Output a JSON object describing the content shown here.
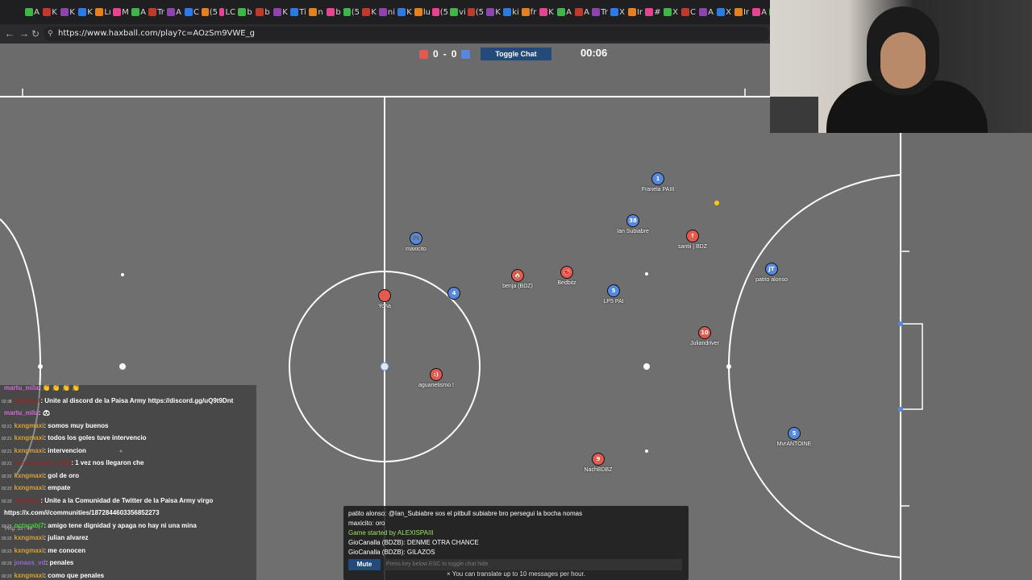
{
  "browser": {
    "url": "https://www.haxball.com/play?c=AOzSm9VWE_g",
    "tabs": [
      "A",
      "K",
      "K",
      "K",
      "Lı",
      "M",
      "A",
      "Tr",
      "A",
      "C",
      "(5",
      "LC",
      "b",
      "b",
      "K",
      "Ti",
      "n",
      "b",
      "(5",
      "K",
      "ni",
      "K",
      "lu",
      "(5",
      "vi",
      "(5",
      "K",
      "ki",
      "fr",
      "K",
      "A",
      "A",
      "Tr",
      "X",
      "Ir",
      "#",
      "X",
      "C",
      "A",
      "X",
      "Ir",
      "A",
      "Si"
    ]
  },
  "game": {
    "score_red": "0",
    "score_separator": "-",
    "score_blue": "0",
    "toggle_chat": "Toggle Chat",
    "clock": "00:06",
    "colors": {
      "red": "#e35a4e",
      "blue": "#5788e0",
      "pitch": "#6b6b6b",
      "lines": "#ffffff",
      "ball": "#ffcc00"
    },
    "players": [
      {
        "team": "blue",
        "number": "1",
        "name": "Franela PAIII"
      },
      {
        "team": "blue",
        "number": "38",
        "name": "Ian Subiabre"
      },
      {
        "team": "red",
        "number": "↑",
        "name": "santii | BDZ"
      },
      {
        "team": "blue",
        "number": "🎮",
        "name": "maxicito"
      },
      {
        "team": "red",
        "number": "🏠",
        "name": "benja (BDZ)"
      },
      {
        "team": "red",
        "number": "🥩",
        "name": "Bedbitz"
      },
      {
        "team": "blue",
        "number": "5",
        "name": "LP5 PAI"
      },
      {
        "team": "blue",
        "number": "JT",
        "name": "patito alonso"
      },
      {
        "team": "red",
        "number": "",
        "name": "Yoha"
      },
      {
        "team": "blue",
        "number": "4",
        "name": ""
      },
      {
        "team": "red",
        "number": "10",
        "name": "Juliandriver"
      },
      {
        "team": "red",
        "number": ":)",
        "name": "aguanetismo !"
      },
      {
        "team": "blue",
        "number": "5",
        "name": "MvrANTOINE"
      },
      {
        "team": "red",
        "number": "9",
        "name": "NachBDBZ"
      }
    ]
  },
  "stream_chat": {
    "messages": [
      {
        "ts": "",
        "user": "martu_mila",
        "msg": ": 👏 👏 👏 👏",
        "user_color": "#d36ad6"
      },
      {
        "ts": "02:38",
        "user": "Nightbot",
        "msg": ": Unite al discord de la Paisa Army https://discord.gg/uQ9t9Dnt",
        "user_color": "#8a2b2b"
      },
      {
        "ts": "",
        "user": "martu_mila",
        "msg": ": 🐼",
        "user_color": "#d36ad6"
      },
      {
        "ts": "02:21",
        "user": "kxngmaxi",
        "msg": ": somos muy buenos",
        "user_color": "#d6a23a"
      },
      {
        "ts": "02:21",
        "user": "kxngmaxi",
        "msg": ": todos los goles tuve intervencio",
        "user_color": "#d6a23a"
      },
      {
        "ts": "02:21",
        "user": "kxngmaxi",
        "msg": ": intervencion",
        "user_color": "#d6a23a"
      },
      {
        "ts": "02:21",
        "user": "messigoat01_2022",
        "msg": ": 1 vez nos llegaron che",
        "user_color": "#8a2b2b"
      },
      {
        "ts": "02:22",
        "user": "kxngmaxi",
        "msg": ": gol de oro",
        "user_color": "#d6a23a"
      },
      {
        "ts": "02:22",
        "user": "kxngmaxi",
        "msg": ": empate",
        "user_color": "#d6a23a"
      },
      {
        "ts": "02:22",
        "user": "Nightbot",
        "msg": ": Unite a la Comunidad de Twitter de la Paisa Army virgo",
        "user_color": "#8a2b2b"
      },
      {
        "ts": "",
        "user": "",
        "msg": "https://x.com/i/communities/1872844603356852273",
        "user_color": "#ffffff"
      },
      {
        "ts": "02:23",
        "user": "octacabj7",
        "msg": ": amigo tene dignidad y apaga no hay ni una mina",
        "user_color": "#3fcf3f"
      },
      {
        "ts": "02:23",
        "user": "kxngmaxi",
        "msg": ": julian alvarez",
        "user_color": "#d6a23a"
      },
      {
        "ts": "02:23",
        "user": "kxngmaxi",
        "msg": ": me conocen",
        "user_color": "#d6a23a"
      },
      {
        "ts": "02:23",
        "user": "jonass_vd",
        "msg": ": penales",
        "user_color": "#8f6ad6"
      },
      {
        "ts": "02:23",
        "user": "kxngmaxi",
        "msg": ": como que penales",
        "user_color": "#d6a23a"
      }
    ],
    "ping": "Ping: 33 - 44"
  },
  "game_chat": {
    "lines": [
      {
        "text": "patito alonso: @Ian_Subiabre sos el pitbull subiabre bro persegui la bocha nomas",
        "type": "normal"
      },
      {
        "text": "maxicito: oro",
        "type": "normal"
      },
      {
        "text": "Game started by ALEXISPAIII",
        "type": "green"
      },
      {
        "text": "GioCanalla (BDZB): DENME OTRA CHANCE",
        "type": "normal"
      },
      {
        "text": "GioCanalla (BDZB): GILAZOS",
        "type": "normal"
      }
    ],
    "mute_label": "Mute",
    "input_placeholder": "Press key below ESC to toggle chat hide",
    "translate_note": "× You can translate up to 10 messages per hour."
  }
}
